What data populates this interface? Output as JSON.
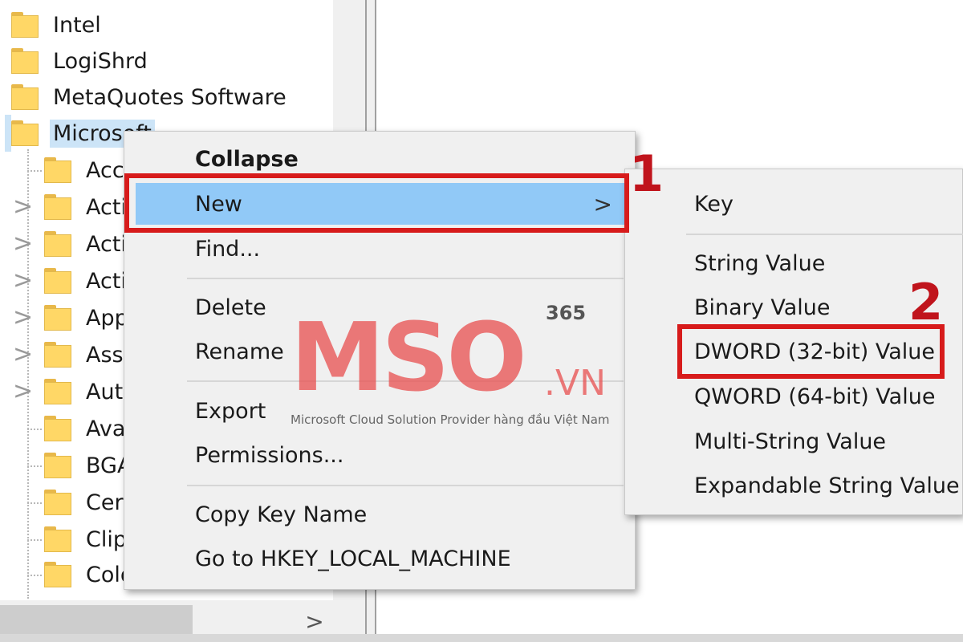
{
  "tree": {
    "items": [
      {
        "label": "Intel",
        "expander": ""
      },
      {
        "label": "LogiShrd",
        "expander": ""
      },
      {
        "label": "MetaQuotes Software",
        "expander": ""
      },
      {
        "label": "Microsoft",
        "expander": "",
        "selected": true
      },
      {
        "label": "Acc",
        "expander": ""
      },
      {
        "label": "Acti",
        "expander": ">"
      },
      {
        "label": "Acti",
        "expander": ">"
      },
      {
        "label": "Acti",
        "expander": ">"
      },
      {
        "label": "App",
        "expander": ">"
      },
      {
        "label": "Assi",
        "expander": ">"
      },
      {
        "label": "Aut",
        "expander": ">"
      },
      {
        "label": "Ava",
        "expander": ""
      },
      {
        "label": "BGA",
        "expander": ""
      },
      {
        "label": "Cert",
        "expander": ""
      },
      {
        "label": "Clip",
        "expander": ""
      },
      {
        "label": "Colo",
        "expander": ""
      }
    ],
    "scroll_right_icon": ">"
  },
  "context_menu": {
    "items": [
      {
        "label": "Collapse",
        "bold": true
      },
      {
        "label": "New",
        "highlighted": true,
        "submenu_arrow": ">"
      },
      {
        "label": "Find..."
      },
      {
        "label": "Delete"
      },
      {
        "label": "Rename"
      },
      {
        "label": "Export"
      },
      {
        "label": "Permissions..."
      },
      {
        "label": "Copy Key Name"
      },
      {
        "label": "Go to HKEY_LOCAL_MACHINE"
      }
    ]
  },
  "submenu": {
    "items": [
      {
        "label": "Key"
      },
      {
        "label": "String Value"
      },
      {
        "label": "Binary Value"
      },
      {
        "label": "DWORD (32-bit) Value",
        "annotated": true
      },
      {
        "label": "QWORD (64-bit) Value"
      },
      {
        "label": "Multi-String Value"
      },
      {
        "label": "Expandable String Value"
      }
    ]
  },
  "annotations": {
    "step1": "1",
    "step2": "2",
    "highlight_color": "#d71b1b"
  },
  "watermark": {
    "logo": "MSO",
    "superscript": "365",
    "suffix": ".VN",
    "tagline": "Microsoft Cloud Solution Provider hàng đầu Việt Nam"
  }
}
